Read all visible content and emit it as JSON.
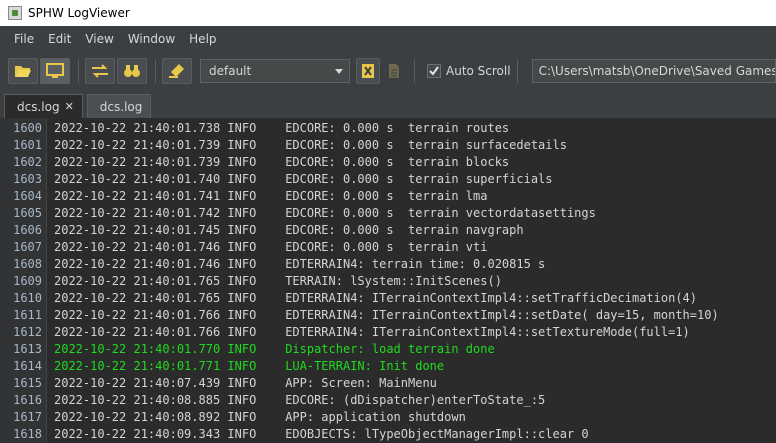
{
  "window": {
    "title": "SPHW LogViewer"
  },
  "menu": [
    "File",
    "Edit",
    "View",
    "Window",
    "Help"
  ],
  "toolbar": {
    "filter_selected": "default",
    "autoscroll_label": "Auto Scroll",
    "autoscroll_checked": true,
    "path": "C:\\Users\\matsb\\OneDrive\\Saved Games\\DCS"
  },
  "tabs": [
    {
      "label": "dcs.log",
      "active": true,
      "closable": true
    },
    {
      "label": "dcs.log",
      "active": false,
      "closable": false
    }
  ],
  "log": {
    "lines": [
      {
        "n": "1600",
        "text": "2022-10-22 21:40:01.738 INFO    EDCORE: 0.000 s  terrain routes",
        "color": "default"
      },
      {
        "n": "1601",
        "text": "2022-10-22 21:40:01.739 INFO    EDCORE: 0.000 s  terrain surfacedetails",
        "color": "default"
      },
      {
        "n": "1602",
        "text": "2022-10-22 21:40:01.739 INFO    EDCORE: 0.000 s  terrain blocks",
        "color": "default"
      },
      {
        "n": "1603",
        "text": "2022-10-22 21:40:01.740 INFO    EDCORE: 0.000 s  terrain superficials",
        "color": "default"
      },
      {
        "n": "1604",
        "text": "2022-10-22 21:40:01.741 INFO    EDCORE: 0.000 s  terrain lma",
        "color": "default"
      },
      {
        "n": "1605",
        "text": "2022-10-22 21:40:01.742 INFO    EDCORE: 0.000 s  terrain vectordatasettings",
        "color": "default"
      },
      {
        "n": "1606",
        "text": "2022-10-22 21:40:01.745 INFO    EDCORE: 0.000 s  terrain navgraph",
        "color": "default"
      },
      {
        "n": "1607",
        "text": "2022-10-22 21:40:01.746 INFO    EDCORE: 0.000 s  terrain vti",
        "color": "default"
      },
      {
        "n": "1608",
        "text": "2022-10-22 21:40:01.746 INFO    EDTERRAIN4: terrain time: 0.020815 s",
        "color": "default"
      },
      {
        "n": "1609",
        "text": "2022-10-22 21:40:01.765 INFO    TERRAIN: lSystem::InitScenes()",
        "color": "default"
      },
      {
        "n": "1610",
        "text": "2022-10-22 21:40:01.765 INFO    EDTERRAIN4: ITerrainContextImpl4::setTrafficDecimation(4)",
        "color": "default"
      },
      {
        "n": "1611",
        "text": "2022-10-22 21:40:01.766 INFO    EDTERRAIN4: ITerrainContextImpl4::setDate( day=15, month=10)",
        "color": "default"
      },
      {
        "n": "1612",
        "text": "2022-10-22 21:40:01.766 INFO    EDTERRAIN4: ITerrainContextImpl4::setTextureMode(full=1)",
        "color": "default"
      },
      {
        "n": "1613",
        "text": "2022-10-22 21:40:01.770 INFO    Dispatcher: load terrain done",
        "color": "green"
      },
      {
        "n": "1614",
        "text": "2022-10-22 21:40:01.771 INFO    LUA-TERRAIN: Init done",
        "color": "green"
      },
      {
        "n": "1615",
        "text": "2022-10-22 21:40:07.439 INFO    APP: Screen: MainMenu",
        "color": "default"
      },
      {
        "n": "1616",
        "text": "2022-10-22 21:40:08.885 INFO    EDCORE: (dDispatcher)enterToState_:5",
        "color": "default"
      },
      {
        "n": "1617",
        "text": "2022-10-22 21:40:08.892 INFO    APP: application shutdown",
        "color": "default"
      },
      {
        "n": "1618",
        "text": "2022-10-22 21:40:09.343 INFO    EDOBJECTS: lTypeObjectManagerImpl::clear 0",
        "color": "default"
      }
    ]
  },
  "colors": {
    "highlight": "#1ddc1d",
    "background": "#2b2b2b",
    "chrome": "#3c3f41",
    "accent_yellow": "#e8c84a"
  }
}
